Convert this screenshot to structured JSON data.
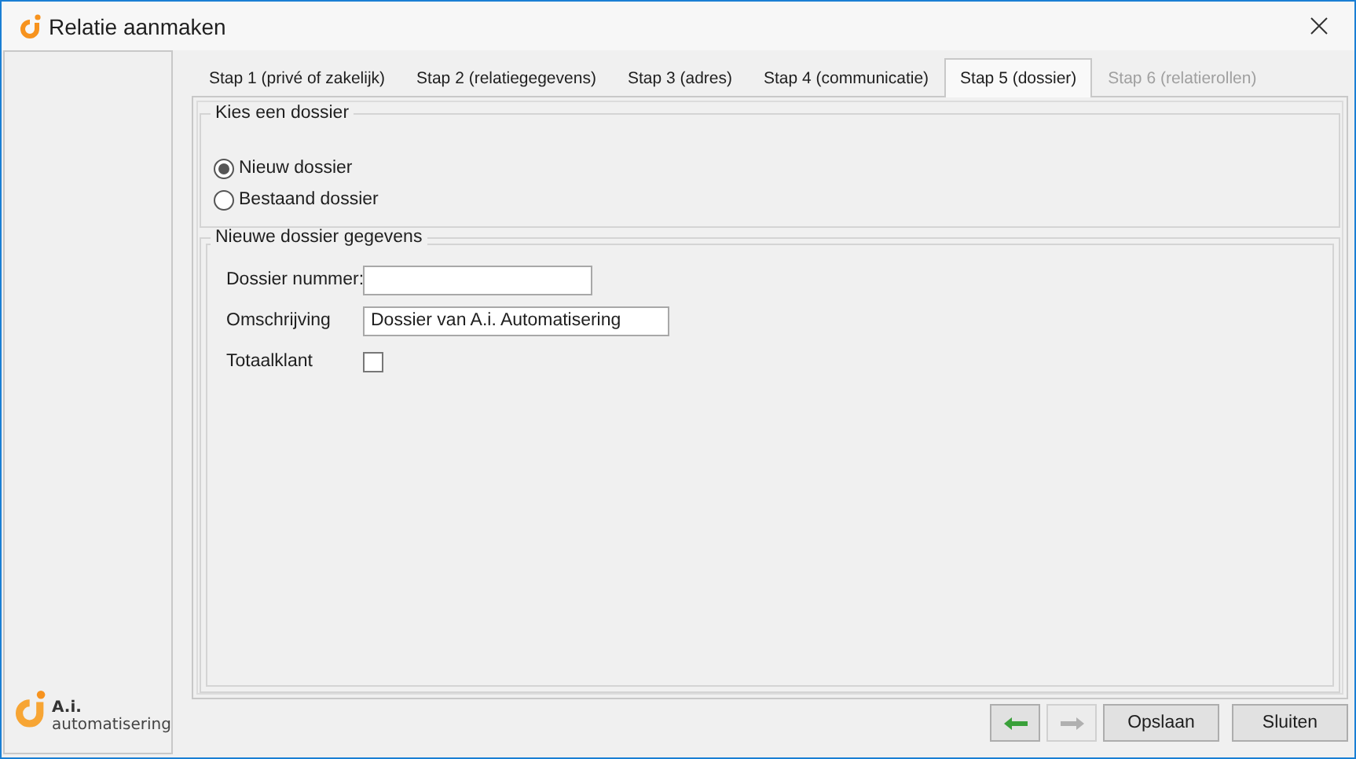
{
  "window": {
    "title": "Relatie aanmaken"
  },
  "logo": {
    "name": "A.i.",
    "tagline": "automatisering"
  },
  "tabs": [
    {
      "label": "Stap 1 (privé of zakelijk)",
      "selected": false,
      "disabled": false
    },
    {
      "label": "Stap 2 (relatiegegevens)",
      "selected": false,
      "disabled": false
    },
    {
      "label": "Stap 3 (adres)",
      "selected": false,
      "disabled": false
    },
    {
      "label": "Stap 4 (communicatie)",
      "selected": false,
      "disabled": false
    },
    {
      "label": "Stap 5 (dossier)",
      "selected": true,
      "disabled": false
    },
    {
      "label": "Stap 6 (relatierollen)",
      "selected": false,
      "disabled": true
    }
  ],
  "choose_group": {
    "title": "Kies een dossier",
    "options": [
      {
        "label": "Nieuw dossier",
        "selected": true
      },
      {
        "label": "Bestaand dossier",
        "selected": false
      }
    ]
  },
  "details_group": {
    "title": "Nieuwe dossier gegevens",
    "fields": [
      {
        "kind": "text",
        "label": "Dossier nummer:"
      },
      {
        "kind": "text",
        "label": "Omschrijving",
        "value": "Dossier van A.i. Automatisering"
      },
      {
        "kind": "checkbox",
        "label": "Totaalklant",
        "checked": false
      }
    ]
  },
  "buttons": [
    {
      "kind": "back",
      "disabled": false
    },
    {
      "kind": "forward",
      "disabled": true
    },
    {
      "kind": "text",
      "label": "Opslaan",
      "disabled": false
    },
    {
      "kind": "text",
      "label": "Sluiten",
      "disabled": false
    }
  ]
}
